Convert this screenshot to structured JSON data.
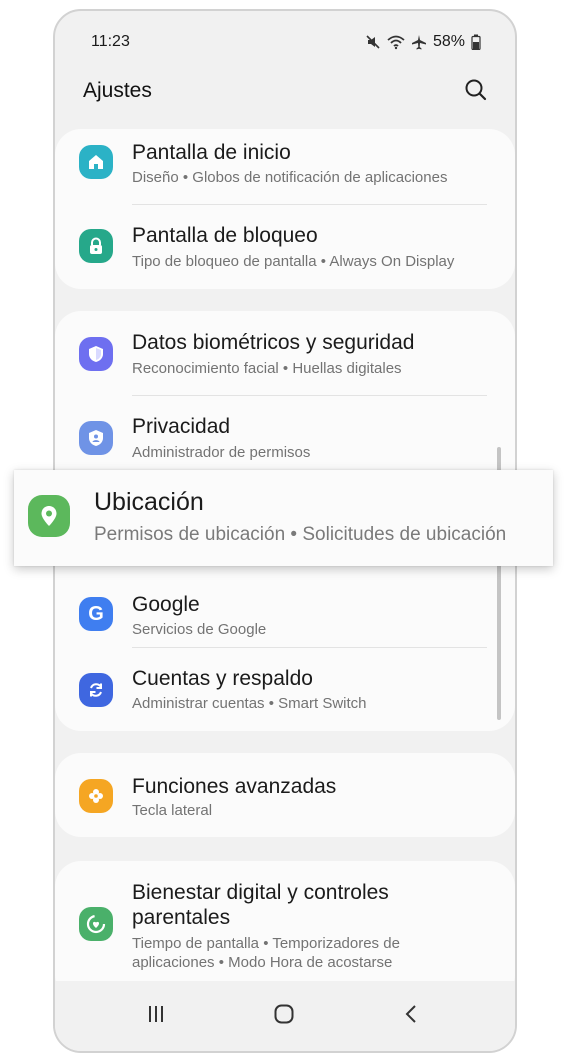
{
  "status": {
    "time": "11:23",
    "battery": "58%"
  },
  "header": {
    "title": "Ajustes"
  },
  "items": {
    "home_screen": {
      "title": "Pantalla de inicio",
      "subtitle": "Diseño  •  Globos de notificación de aplicaciones",
      "color": "#2bb2c6"
    },
    "lock_screen": {
      "title": "Pantalla de bloqueo",
      "subtitle": "Tipo de bloqueo de pantalla  •  Always On Display",
      "color": "#26a88a"
    },
    "biometrics": {
      "title": "Datos biométricos y seguridad",
      "subtitle": "Reconocimiento facial  •  Huellas digitales",
      "color": "#6e6ff0"
    },
    "privacy": {
      "title": "Privacidad",
      "subtitle": "Administrador de permisos",
      "color": "#6f93e6"
    },
    "location": {
      "title": "Ubicación",
      "subtitle": "Permisos de ubicación  •  Solicitudes de ubicación",
      "color": "#5cb85c"
    },
    "google": {
      "title": "Google",
      "subtitle": "Servicios de Google",
      "color": "#3f7ef0"
    },
    "accounts": {
      "title": "Cuentas y respaldo",
      "subtitle": "Administrar cuentas  •  Smart Switch",
      "color": "#3f67e0"
    },
    "advanced": {
      "title": "Funciones avanzadas",
      "subtitle": "Tecla lateral",
      "color": "#f5a623"
    },
    "wellbeing": {
      "title_line1": "Bienestar digital y controles",
      "title_line2": "parentales",
      "subtitle_line1": "Tiempo de pantalla  •  Temporizadores de",
      "subtitle_line2": "aplicaciones  •  Modo Hora de acostarse",
      "color": "#4ab06a"
    }
  },
  "icons": {
    "home": "home-icon",
    "lock": "lock-icon",
    "shield": "shield-icon",
    "privacy": "privacy-icon",
    "location": "location-pin-icon",
    "google": "google-icon",
    "sync": "sync-icon",
    "advanced": "puzzle-icon",
    "wellbeing": "wellbeing-icon",
    "search": "search-icon",
    "recents": "recents-icon",
    "home_nav": "home-nav-icon",
    "back": "back-icon"
  }
}
